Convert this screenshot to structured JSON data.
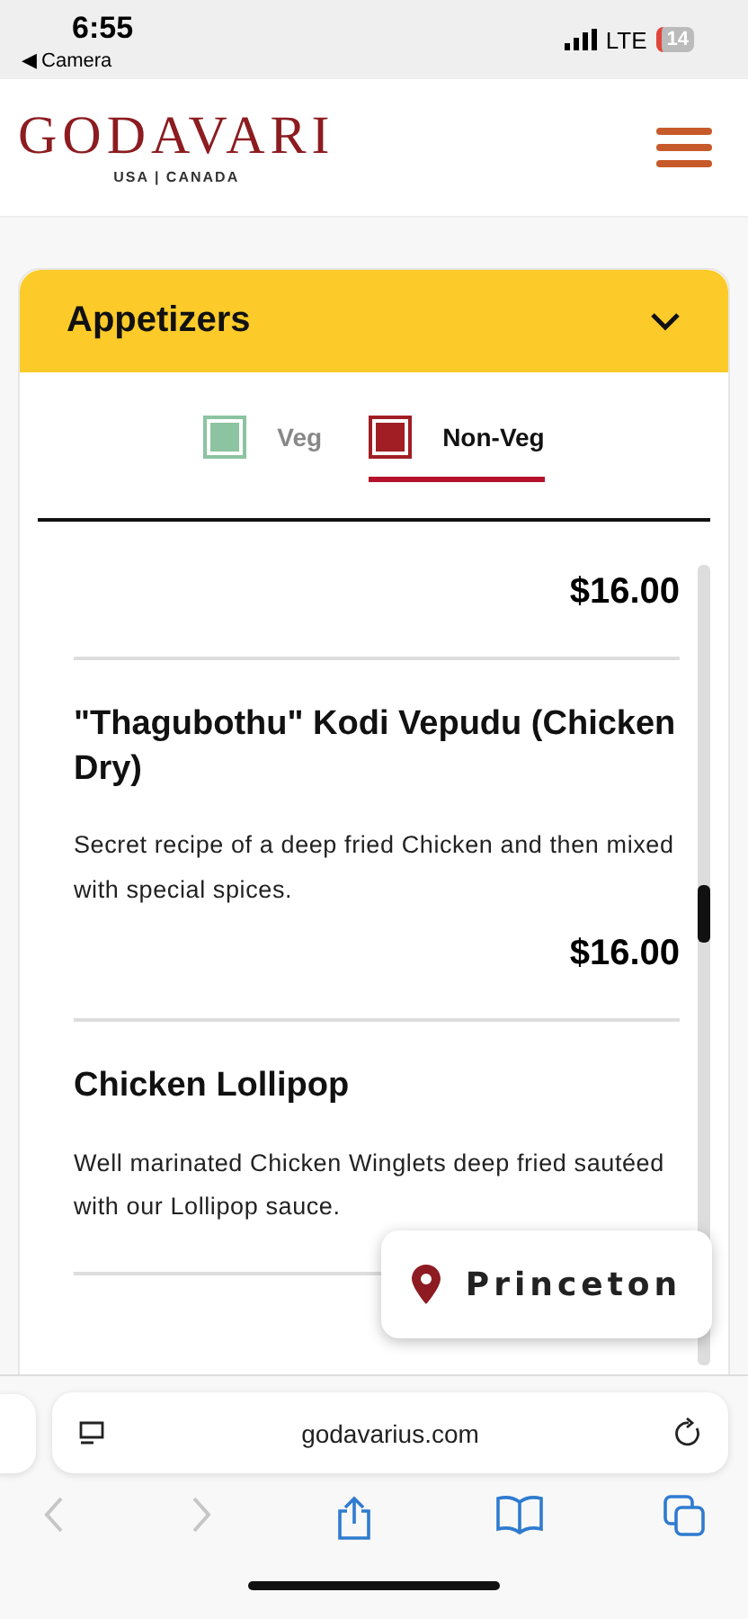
{
  "status_bar": {
    "time": "6:55",
    "back_link": "◀ Camera",
    "network": "LTE",
    "battery": "14"
  },
  "header": {
    "logo": "GODAVARI",
    "logo_subtitle": "USA | CANADA"
  },
  "category": {
    "title": "Appetizers",
    "expanded": true
  },
  "filters": [
    {
      "label": "Veg",
      "selected": false,
      "color": "#8cc3a0"
    },
    {
      "label": "Non-Veg",
      "selected": true,
      "color": "#a01e24"
    }
  ],
  "items": [
    {
      "price": "$16.00"
    },
    {
      "name": "\"Thagubothu\" Kodi Vepudu (Chicken Dry)",
      "description": "Secret recipe of a deep fried Chicken and then mixed with special spices.",
      "price": "$16.00"
    },
    {
      "name": "Chicken Lollipop",
      "description": "Well marinated Chicken Winglets deep fried sautéed with our Lollipop sauce."
    }
  ],
  "location_button": {
    "label": "Princeton"
  },
  "browser": {
    "url": "godavarius.com"
  }
}
